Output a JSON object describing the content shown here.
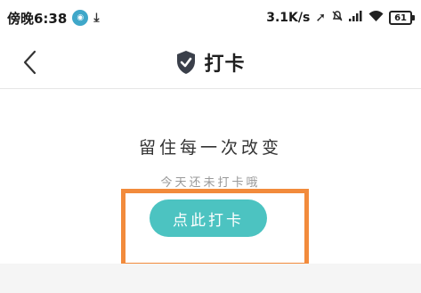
{
  "status_bar": {
    "time": "傍晚6:38",
    "network_speed": "3.1K/s",
    "battery": "61"
  },
  "header": {
    "title": "打卡"
  },
  "main": {
    "slogan": "留住每一次改变",
    "subtext": "今天还未打卡哦",
    "checkin_button_label": "点此打卡"
  },
  "colors": {
    "accent": "#4cc3c1",
    "highlight": "#f28b3c"
  }
}
